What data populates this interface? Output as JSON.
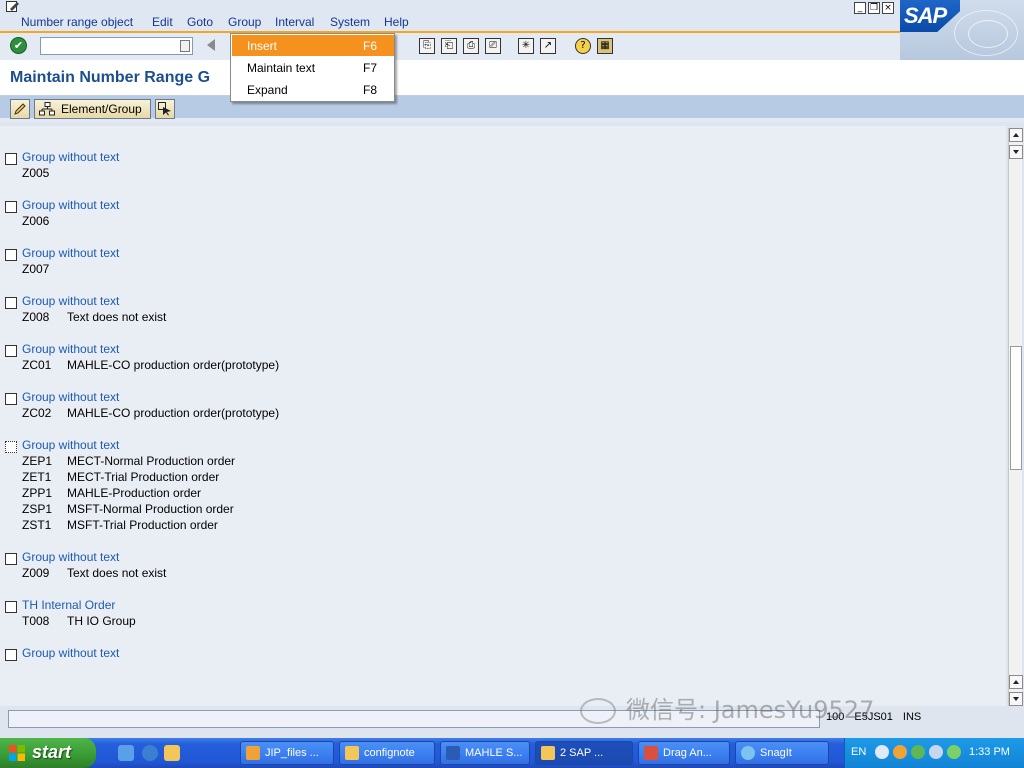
{
  "menu": {
    "items": [
      "Number range object",
      "Edit",
      "Goto",
      "Group",
      "Interval",
      "System",
      "Help"
    ]
  },
  "window_controls": [
    "_",
    "❐",
    "×"
  ],
  "sap_logo": "SAP",
  "title": "Maintain Number Range G",
  "app_toolbar": {
    "element_group_label": "Element/Group"
  },
  "dropdown": {
    "items": [
      {
        "label": "Insert",
        "key": "F6"
      },
      {
        "label": "Maintain text",
        "key": "F7"
      },
      {
        "label": "Expand",
        "key": "F8"
      }
    ]
  },
  "groups": [
    {
      "name": "Group without text",
      "rows": [
        {
          "code": "Z005",
          "text": ""
        }
      ]
    },
    {
      "name": "Group without text",
      "rows": [
        {
          "code": "Z006",
          "text": ""
        }
      ]
    },
    {
      "name": "Group without text",
      "rows": [
        {
          "code": "Z007",
          "text": ""
        }
      ]
    },
    {
      "name": "Group without text",
      "rows": [
        {
          "code": "Z008",
          "text": "Text does not exist"
        }
      ]
    },
    {
      "name": "Group without text",
      "rows": [
        {
          "code": "ZC01",
          "text": "MAHLE-CO production order(prototype)"
        }
      ]
    },
    {
      "name": "Group without text",
      "rows": [
        {
          "code": "ZC02",
          "text": "MAHLE-CO production order(prototype)"
        }
      ]
    },
    {
      "name": "Group without text",
      "rows": [
        {
          "code": "ZEP1",
          "text": "MECT-Normal Production order"
        },
        {
          "code": "ZET1",
          "text": "MECT-Trial Production order"
        },
        {
          "code": "ZPP1",
          "text": "MAHLE-Production order"
        },
        {
          "code": "ZSP1",
          "text": "MSFT-Normal Production order"
        },
        {
          "code": "ZST1",
          "text": "MSFT-Trial Production order"
        }
      ]
    },
    {
      "name": "Group without text",
      "rows": [
        {
          "code": "Z009",
          "text": "Text does not exist"
        }
      ]
    },
    {
      "name": "TH Internal Order",
      "rows": [
        {
          "code": "T008",
          "text": "TH IO Group"
        }
      ]
    },
    {
      "name": "Group without text",
      "rows": []
    }
  ],
  "status": {
    "client": "100",
    "server": "E5JS01",
    "mode": "INS"
  },
  "watermark": "微信号: JamesYu9527",
  "taskbar": {
    "start": "start",
    "buttons": [
      "JIP_files ...",
      "confignote",
      "MAHLE S...",
      "2 SAP ...",
      "Drag An...",
      "SnagIt"
    ],
    "lang": "EN",
    "clock": "1:33 PM"
  },
  "colors": {
    "accent": "#f5921e",
    "link": "#1c5bb0",
    "title": "#1c4f8e"
  }
}
